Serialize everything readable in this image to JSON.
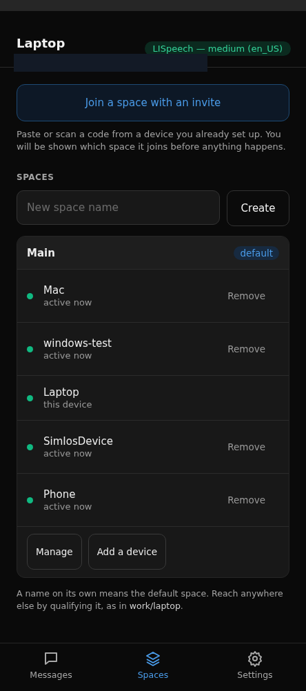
{
  "header": {
    "title": "Laptop",
    "badge": "LISpeech — medium (en_US)"
  },
  "join": {
    "button": "Join a space with an invite",
    "hint": "Paste or scan a code from a device you already set up. You will be shown which space it joins before anything happens."
  },
  "spaces": {
    "heading": "SPACES",
    "new_field": {
      "placeholder": "New space name"
    },
    "create_button": "Create"
  },
  "space": {
    "name": "Main",
    "tag": "default",
    "devices": [
      {
        "name": "Mac",
        "status": "active now",
        "color": "#10b981",
        "action": "Remove"
      },
      {
        "name": "windows-test",
        "status": "active now",
        "color": "#10b981",
        "action": "Remove"
      },
      {
        "name": "Laptop",
        "status": "this device",
        "color": "#10b981"
      },
      {
        "name": "SimIosDevice",
        "status": "active now",
        "color": "#10b981",
        "action": "Remove"
      },
      {
        "name": "Phone",
        "status": "active now",
        "color": "#10b981",
        "action": "Remove"
      }
    ],
    "buttons": [
      "Manage",
      "Add a device"
    ]
  },
  "footnote": "A name on its own means the default space. Reach anywhere else by qualifying it, as in **work/laptop**.",
  "tabs": [
    {
      "label": "Messages",
      "kind": "chat",
      "selected": false
    },
    {
      "label": "Spaces",
      "kind": "layers",
      "selected": true
    },
    {
      "label": "Settings",
      "kind": "gear",
      "selected": false
    }
  ]
}
